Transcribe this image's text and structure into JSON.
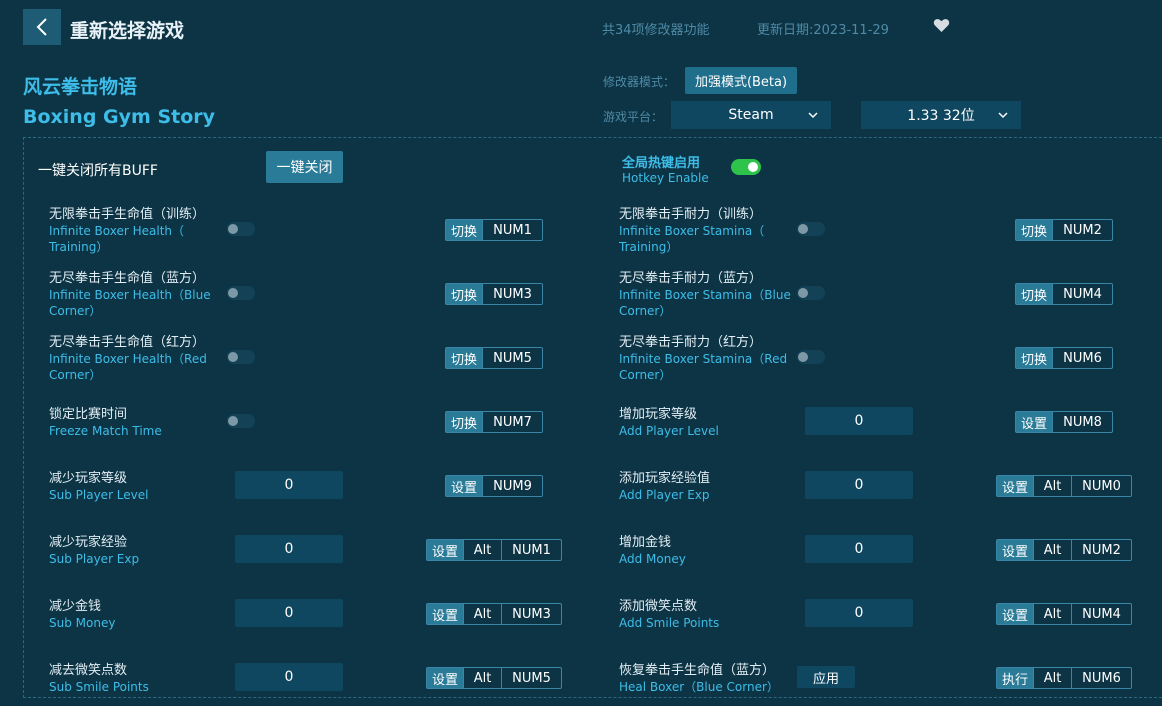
{
  "header": {
    "title": "重新选择游戏",
    "feature_count": "共34项修改器功能",
    "update_date": "更新日期:2023-11-29"
  },
  "game": {
    "name_cn": "风云拳击物语",
    "name_en": "Boxing Gym Story"
  },
  "mode": {
    "label": "修改器模式：",
    "value": "加强模式(Beta)"
  },
  "platform": {
    "label": "游戏平台：",
    "value": "Steam",
    "version": "1.33 32位"
  },
  "buff_all": {
    "label": "一键关闭所有BUFF",
    "button": "一键关闭"
  },
  "hotkey_global": {
    "label_cn": "全局热键启用",
    "label_en": "Hotkey Enable",
    "enabled": true
  },
  "options": [
    {
      "cn": "无限拳击手生命值（训练）",
      "en1": "Infinite Boxer Health（",
      "en2": "Training）",
      "action": "切换",
      "key": "NUM1"
    },
    {
      "cn": "无限拳击手耐力（训练）",
      "en1": "Infinite Boxer Stamina（",
      "en2": "Training）",
      "action": "切换",
      "key": "NUM2"
    },
    {
      "cn": "无尽拳击手生命值（蓝方）",
      "en1": "Infinite Boxer Health（Blue",
      "en2": "Corner）",
      "action": "切换",
      "key": "NUM3"
    },
    {
      "cn": "无尽拳击手耐力（蓝方）",
      "en1": "Infinite Boxer Stamina（Blue",
      "en2": "Corner）",
      "action": "切换",
      "key": "NUM4"
    },
    {
      "cn": "无尽拳击手生命值（红方）",
      "en1": "Infinite Boxer Health（Red",
      "en2": "Corner）",
      "action": "切换",
      "key": "NUM5"
    },
    {
      "cn": "无尽拳击手耐力（红方）",
      "en1": "Infinite Boxer Stamina（Red",
      "en2": "Corner）",
      "action": "切换",
      "key": "NUM6"
    },
    {
      "cn": "锁定比赛时间",
      "en1": "Freeze Match Time",
      "action": "切换",
      "key": "NUM7"
    },
    {
      "cn": "增加玩家等级",
      "en1": "Add Player Level",
      "value": "0",
      "action": "设置",
      "key": "NUM8"
    },
    {
      "cn": "减少玩家等级",
      "en1": "Sub Player Level",
      "value": "0",
      "action": "设置",
      "key": "NUM9"
    },
    {
      "cn": "添加玩家经验值",
      "en1": "Add Player Exp",
      "value": "0",
      "action": "设置",
      "mod": "Alt",
      "key": "NUM0"
    },
    {
      "cn": "减少玩家经验",
      "en1": "Sub Player Exp",
      "value": "0",
      "action": "设置",
      "mod": "Alt",
      "key": "NUM1"
    },
    {
      "cn": "增加金钱",
      "en1": "Add Money",
      "value": "0",
      "action": "设置",
      "mod": "Alt",
      "key": "NUM2"
    },
    {
      "cn": "减少金钱",
      "en1": "Sub Money",
      "value": "0",
      "action": "设置",
      "mod": "Alt",
      "key": "NUM3"
    },
    {
      "cn": "添加微笑点数",
      "en1": "Add Smile Points",
      "value": "0",
      "action": "设置",
      "mod": "Alt",
      "key": "NUM4"
    },
    {
      "cn": "减去微笑点数",
      "en1": "Sub Smile Points",
      "value": "0",
      "action": "设置",
      "mod": "Alt",
      "key": "NUM5"
    },
    {
      "cn": "恢复拳击手生命值（蓝方）",
      "en1": "Heal Boxer（Blue Corner）",
      "apply": "应用",
      "action": "执行",
      "mod": "Alt",
      "key": "NUM6"
    }
  ]
}
